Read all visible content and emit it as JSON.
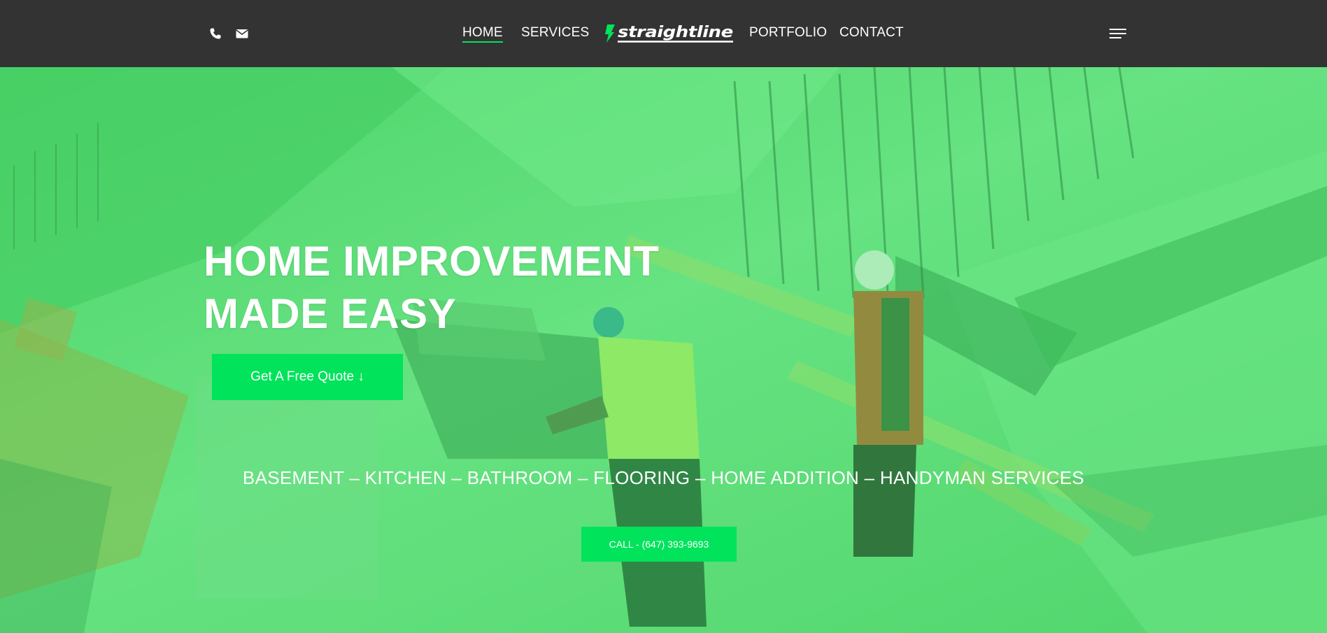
{
  "header": {
    "phone_icon": "phone-icon",
    "email_icon": "envelope-icon",
    "nav_left": [
      {
        "label": "HOME",
        "active": true
      },
      {
        "label": "SERVICES",
        "active": false
      }
    ],
    "logo_text": "straightline",
    "nav_right": [
      {
        "label": "PORTFOLIO",
        "active": false
      },
      {
        "label": "CONTACT",
        "active": false
      }
    ],
    "menu_icon": "hamburger-menu-icon"
  },
  "hero": {
    "title_line1": "HOME IMPROVEMENT",
    "title_line2": "MADE EASY",
    "quote_button": "Get A Free Quote ↓",
    "services": "BASEMENT – KITCHEN – BATHROOM – FLOORING – HOME ADDITION – HANDYMAN SERVICES",
    "call_button": "CALL - (647) 393-9693"
  },
  "colors": {
    "header_bg": "#333333",
    "accent_green": "#00e35b",
    "overlay_green": "#3ddc5f",
    "text": "#ffffff"
  }
}
